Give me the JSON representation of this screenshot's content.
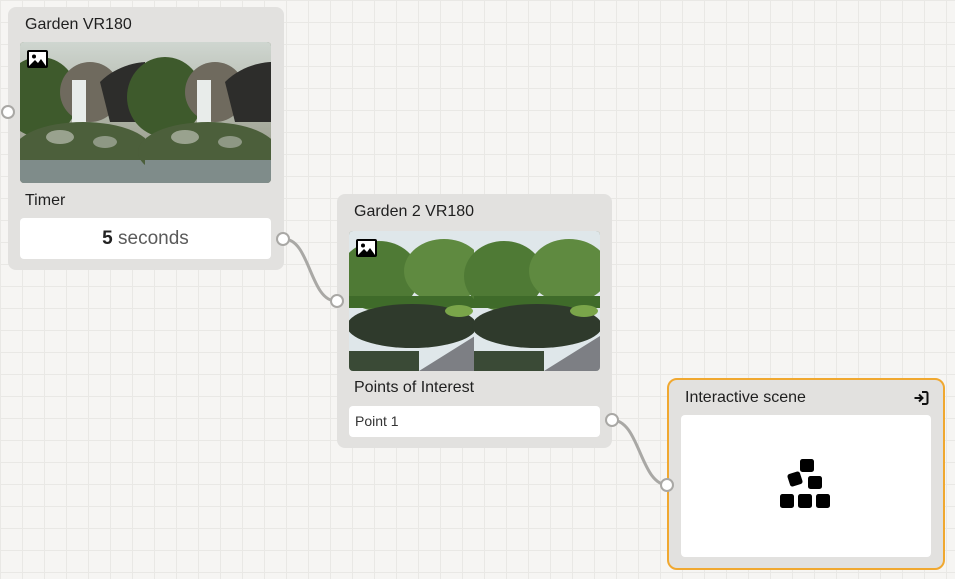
{
  "nodes": {
    "garden": {
      "title": "Garden VR180",
      "section_label": "Timer",
      "timer_value": "5",
      "timer_unit": "seconds",
      "image_icon": "image-icon"
    },
    "garden2": {
      "title": "Garden 2 VR180",
      "section_label": "Points of Interest",
      "point_label": "Point 1",
      "image_icon": "image-icon"
    },
    "interactive": {
      "title": "Interactive scene",
      "header_icon": "enter-icon",
      "body_icon": "blocks-icon",
      "accent_color": "#f0a830"
    }
  },
  "colors": {
    "canvas": "#f6f5f3",
    "node_bg": "#e2e1df",
    "wire": "#a9a8a5"
  }
}
